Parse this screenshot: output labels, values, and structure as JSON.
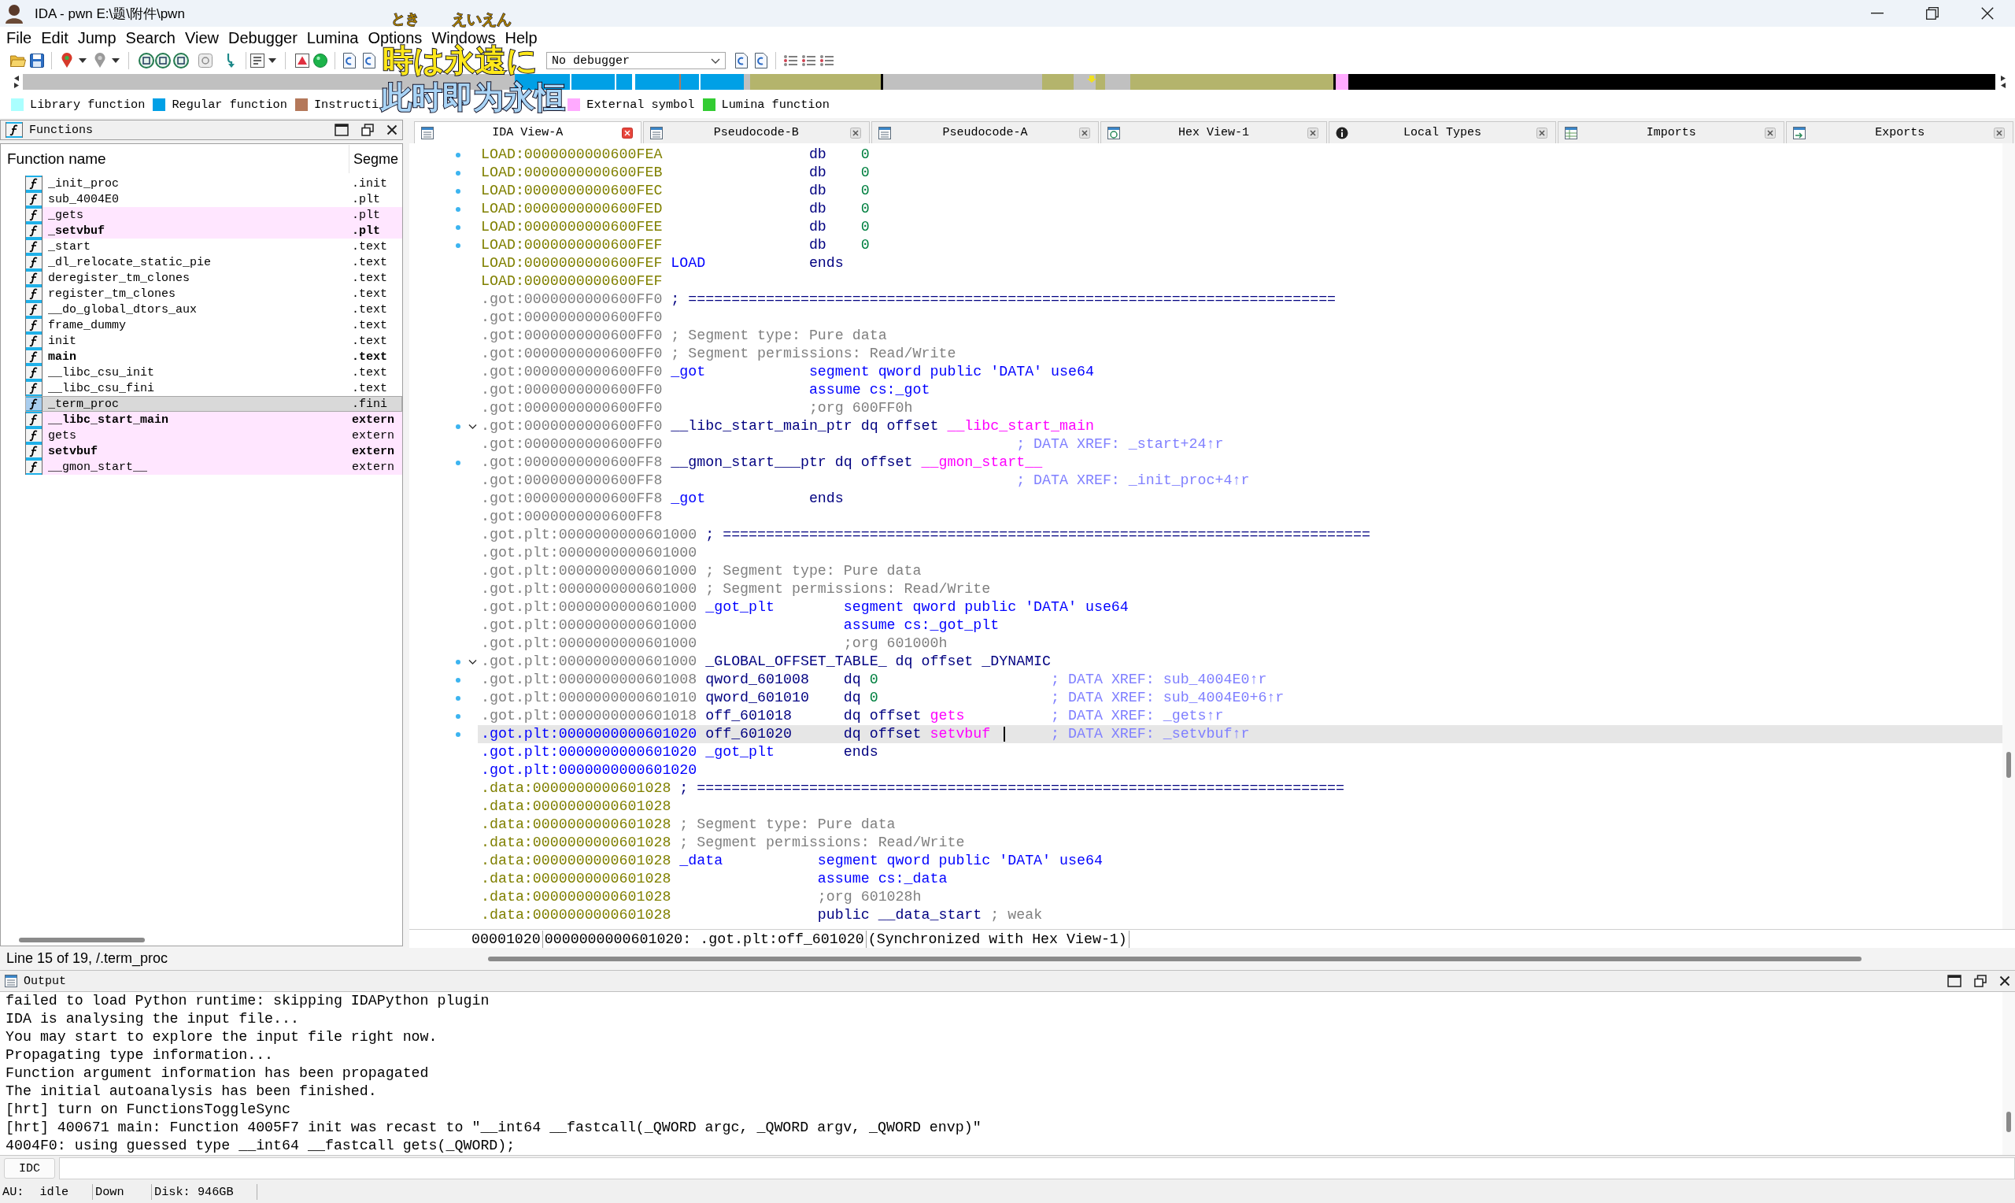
{
  "window": {
    "title": "IDA - pwn E:\\题\\附件\\pwn"
  },
  "menu": [
    "File",
    "Edit",
    "Jump",
    "Search",
    "View",
    "Debugger",
    "Lumina",
    "Options",
    "Windows",
    "Help"
  ],
  "toolbar": {
    "debugger_select": "No debugger"
  },
  "legend": [
    {
      "label": "Library function",
      "color": "#aaffff"
    },
    {
      "label": "Regular function",
      "color": "#00a0e6"
    },
    {
      "label": "Instructi",
      "color": "#b4785a"
    },
    {
      "label": "External symbol",
      "color": "#ffaaff"
    },
    {
      "label": "Lumina function",
      "color": "#33cc33"
    }
  ],
  "lyrics_overlay": {
    "furigana": [
      "とき",
      "えいえん"
    ],
    "lines": [
      "時は永遠に",
      "此时即为永恒"
    ]
  },
  "functions_panel": {
    "title": "Functions",
    "columns": [
      "Function name",
      "Segme"
    ],
    "rows": [
      {
        "name": "_init_proc",
        "segment": ".init",
        "bold": false,
        "color": "#ffffff",
        "selected": false
      },
      {
        "name": "sub_4004E0",
        "segment": ".plt",
        "bold": false,
        "color": "#ffffff",
        "selected": false
      },
      {
        "name": "_gets",
        "segment": ".plt",
        "bold": false,
        "color": "#ffe6ff",
        "selected": false
      },
      {
        "name": "_setvbuf",
        "segment": ".plt",
        "bold": true,
        "color": "#ffe6ff",
        "selected": false
      },
      {
        "name": "_start",
        "segment": ".text",
        "bold": false,
        "color": "#ffffff",
        "selected": false
      },
      {
        "name": "_dl_relocate_static_pie",
        "segment": ".text",
        "bold": false,
        "color": "#ffffff",
        "selected": false
      },
      {
        "name": "deregister_tm_clones",
        "segment": ".text",
        "bold": false,
        "color": "#ffffff",
        "selected": false
      },
      {
        "name": "register_tm_clones",
        "segment": ".text",
        "bold": false,
        "color": "#ffffff",
        "selected": false
      },
      {
        "name": "__do_global_dtors_aux",
        "segment": ".text",
        "bold": false,
        "color": "#ffffff",
        "selected": false
      },
      {
        "name": "frame_dummy",
        "segment": ".text",
        "bold": false,
        "color": "#ffffff",
        "selected": false
      },
      {
        "name": "init",
        "segment": ".text",
        "bold": false,
        "color": "#ffffff",
        "selected": false
      },
      {
        "name": "main",
        "segment": ".text",
        "bold": true,
        "color": "#ffffff",
        "selected": false
      },
      {
        "name": "__libc_csu_init",
        "segment": ".text",
        "bold": false,
        "color": "#ffffff",
        "selected": false
      },
      {
        "name": "__libc_csu_fini",
        "segment": ".text",
        "bold": false,
        "color": "#ffffff",
        "selected": false
      },
      {
        "name": "_term_proc",
        "segment": ".fini",
        "bold": false,
        "selected": true
      },
      {
        "name": "__libc_start_main",
        "segment": "extern",
        "bold": true,
        "color": "#ffe6ff",
        "selected": false
      },
      {
        "name": "gets",
        "segment": "extern",
        "bold": false,
        "color": "#ffe6ff",
        "selected": false
      },
      {
        "name": "setvbuf",
        "segment": "extern",
        "bold": true,
        "color": "#ffe6ff",
        "selected": false
      },
      {
        "name": "__gmon_start__",
        "segment": "extern",
        "bold": false,
        "color": "#ffe6ff",
        "selected": false
      }
    ],
    "status": "Line 15 of 19, /.term_proc"
  },
  "tabs": [
    {
      "label": "IDA View-A",
      "kind": "disassembly",
      "selected": true
    },
    {
      "label": "Pseudocode-B",
      "kind": "pseudocode",
      "selected": false
    },
    {
      "label": "Pseudocode-A",
      "kind": "pseudocode",
      "selected": false
    },
    {
      "label": "Hex View-1",
      "kind": "hex",
      "selected": false
    },
    {
      "label": "Local Types",
      "kind": "types",
      "selected": false
    },
    {
      "label": "Imports",
      "kind": "imports",
      "selected": false
    },
    {
      "label": "Exports",
      "kind": "exports",
      "selected": false
    }
  ],
  "listing": {
    "lines": [
      {
        "address": "LOAD:0000000000600FEA",
        "color": "#808000",
        "marked": true,
        "selected": false,
        "parts": [
          {
            "kind": "code",
            "text": "                 db    "
          },
          {
            "kind": "number",
            "text": "0"
          }
        ]
      },
      {
        "address": "LOAD:0000000000600FEB",
        "color": "#808000",
        "marked": true,
        "selected": false,
        "parts": [
          {
            "kind": "code",
            "text": "                 db    "
          },
          {
            "kind": "number",
            "text": "0"
          }
        ]
      },
      {
        "address": "LOAD:0000000000600FEC",
        "color": "#808000",
        "marked": true,
        "selected": false,
        "parts": [
          {
            "kind": "code",
            "text": "                 db    "
          },
          {
            "kind": "number",
            "text": "0"
          }
        ]
      },
      {
        "address": "LOAD:0000000000600FED",
        "color": "#808000",
        "marked": true,
        "selected": false,
        "parts": [
          {
            "kind": "code",
            "text": "                 db    "
          },
          {
            "kind": "number",
            "text": "0"
          }
        ]
      },
      {
        "address": "LOAD:0000000000600FEE",
        "color": "#808000",
        "marked": true,
        "selected": false,
        "parts": [
          {
            "kind": "code",
            "text": "                 db    "
          },
          {
            "kind": "number",
            "text": "0"
          }
        ]
      },
      {
        "address": "LOAD:0000000000600FEF",
        "color": "#808000",
        "marked": true,
        "selected": false,
        "parts": [
          {
            "kind": "code",
            "text": "                 db    "
          },
          {
            "kind": "number",
            "text": "0"
          }
        ]
      },
      {
        "address": "LOAD:0000000000600FEF",
        "color": "#808000",
        "marked": false,
        "selected": false,
        "parts": [
          {
            "kind": "keyword",
            "text": " LOAD"
          },
          {
            "kind": "code",
            "text": "            ends"
          }
        ]
      },
      {
        "address": "LOAD:0000000000600FEF",
        "color": "#808000",
        "marked": false,
        "selected": false
      },
      {
        "address": ".got:0000000000600FF0",
        "color": "#808080",
        "marked": false,
        "selected": false,
        "parts": [
          {
            "kind": "code",
            "text": " ; ==========================================================================="
          }
        ]
      },
      {
        "address": ".got:0000000000600FF0",
        "color": "#808080",
        "marked": false,
        "selected": false
      },
      {
        "address": ".got:0000000000600FF0",
        "color": "#808080",
        "marked": false,
        "selected": false,
        "parts": [
          {
            "kind": "comment",
            "text": " ; Segment type: Pure data"
          }
        ]
      },
      {
        "address": ".got:0000000000600FF0",
        "color": "#808080",
        "marked": false,
        "selected": false,
        "parts": [
          {
            "kind": "comment",
            "text": " ; Segment permissions: Read/Write"
          }
        ]
      },
      {
        "address": ".got:0000000000600FF0",
        "color": "#808080",
        "marked": false,
        "selected": false,
        "parts": [
          {
            "kind": "keyword",
            "text": " _got            segment qword public 'DATA' use64"
          }
        ]
      },
      {
        "address": ".got:0000000000600FF0",
        "color": "#808080",
        "marked": false,
        "selected": false,
        "parts": [
          {
            "kind": "keyword",
            "text": "                 assume cs:_got"
          }
        ]
      },
      {
        "address": ".got:0000000000600FF0",
        "color": "#808080",
        "marked": false,
        "selected": false,
        "parts": [
          {
            "kind": "comment",
            "text": "                 ;org 600FF0h"
          }
        ]
      },
      {
        "address": ".got:0000000000600FF0",
        "color": "#808080",
        "marked": true,
        "expanded": true,
        "selected": false,
        "parts": [
          {
            "kind": "code",
            "text": " __libc_start_main_ptr dq offset "
          },
          {
            "kind": "import",
            "text": "__libc_start_main"
          }
        ]
      },
      {
        "address": ".got:0000000000600FF0",
        "color": "#808080",
        "marked": false,
        "selected": false,
        "parts": [
          {
            "kind": "xref",
            "text": "                                         ; DATA XREF: _start+24↑r"
          }
        ]
      },
      {
        "address": ".got:0000000000600FF8",
        "color": "#808080",
        "marked": true,
        "selected": false,
        "parts": [
          {
            "kind": "code",
            "text": " __gmon_start___ptr dq offset "
          },
          {
            "kind": "import",
            "text": "__gmon_start__"
          }
        ]
      },
      {
        "address": ".got:0000000000600FF8",
        "color": "#808080",
        "marked": false,
        "selected": false,
        "parts": [
          {
            "kind": "xref",
            "text": "                                         ; DATA XREF: _init_proc+4↑r"
          }
        ]
      },
      {
        "address": ".got:0000000000600FF8",
        "color": "#808080",
        "marked": false,
        "selected": false,
        "parts": [
          {
            "kind": "keyword",
            "text": " _got"
          },
          {
            "kind": "code",
            "text": "            ends"
          }
        ]
      },
      {
        "address": ".got:0000000000600FF8",
        "color": "#808080",
        "marked": false,
        "selected": false
      },
      {
        "address": ".got.plt:0000000000601000",
        "color": "#808080",
        "marked": false,
        "selected": false,
        "parts": [
          {
            "kind": "code",
            "text": " ; ==========================================================================="
          }
        ]
      },
      {
        "address": ".got.plt:0000000000601000",
        "color": "#808080",
        "marked": false,
        "selected": false
      },
      {
        "address": ".got.plt:0000000000601000",
        "color": "#808080",
        "marked": false,
        "selected": false,
        "parts": [
          {
            "kind": "comment",
            "text": " ; Segment type: Pure data"
          }
        ]
      },
      {
        "address": ".got.plt:0000000000601000",
        "color": "#808080",
        "marked": false,
        "selected": false,
        "parts": [
          {
            "kind": "comment",
            "text": " ; Segment permissions: Read/Write"
          }
        ]
      },
      {
        "address": ".got.plt:0000000000601000",
        "color": "#808080",
        "marked": false,
        "selected": false,
        "parts": [
          {
            "kind": "keyword",
            "text": " _got_plt        segment qword public 'DATA' use64"
          }
        ]
      },
      {
        "address": ".got.plt:0000000000601000",
        "color": "#808080",
        "marked": false,
        "selected": false,
        "parts": [
          {
            "kind": "keyword",
            "text": "                 assume cs:_got_plt"
          }
        ]
      },
      {
        "address": ".got.plt:0000000000601000",
        "color": "#808080",
        "marked": false,
        "selected": false,
        "parts": [
          {
            "kind": "comment",
            "text": "                 ;org 601000h"
          }
        ]
      },
      {
        "address": ".got.plt:0000000000601000",
        "color": "#808080",
        "marked": true,
        "expanded": true,
        "selected": false,
        "parts": [
          {
            "kind": "code",
            "text": " _GLOBAL_OFFSET_TABLE_ dq offset _DYNAMIC"
          }
        ]
      },
      {
        "address": ".got.plt:0000000000601008",
        "color": "#808080",
        "marked": true,
        "selected": false,
        "parts": [
          {
            "kind": "code",
            "text": " qword_601008    dq "
          },
          {
            "kind": "number",
            "text": "0"
          },
          {
            "kind": "xref",
            "text": "                    ; DATA XREF: sub_4004E0↑r"
          }
        ]
      },
      {
        "address": ".got.plt:0000000000601010",
        "color": "#808080",
        "marked": true,
        "selected": false,
        "parts": [
          {
            "kind": "code",
            "text": " qword_601010    dq "
          },
          {
            "kind": "number",
            "text": "0"
          },
          {
            "kind": "xref",
            "text": "                    ; DATA XREF: sub_4004E0+6↑r"
          }
        ]
      },
      {
        "address": ".got.plt:0000000000601018",
        "color": "#808080",
        "marked": true,
        "selected": false,
        "parts": [
          {
            "kind": "code",
            "text": " off_601018      dq offset "
          },
          {
            "kind": "import",
            "text": "gets"
          },
          {
            "kind": "xref",
            "text": "          ; DATA XREF: _gets↑r"
          }
        ]
      },
      {
        "address": ".got.plt:0000000000601020",
        "color": "#0000ff",
        "marked": true,
        "selected": true,
        "parts": [
          {
            "kind": "code",
            "text": " off_601020      dq offset "
          },
          {
            "kind": "import",
            "text": "setvbuf"
          },
          {
            "kind": "caret"
          },
          {
            "kind": "xref",
            "text": "       ; DATA XREF: _setvbuf↑r"
          }
        ]
      },
      {
        "address": ".got.plt:0000000000601020",
        "color": "#0000ff",
        "marked": false,
        "selected": false,
        "parts": [
          {
            "kind": "keyword",
            "text": " _got_plt"
          },
          {
            "kind": "code",
            "text": "        ends"
          }
        ]
      },
      {
        "address": ".got.plt:0000000000601020",
        "color": "#0000ff",
        "marked": false,
        "selected": false
      },
      {
        "address": ".data:0000000000601028",
        "color": "#808000",
        "marked": false,
        "selected": false,
        "parts": [
          {
            "kind": "code",
            "text": " ; ==========================================================================="
          }
        ]
      },
      {
        "address": ".data:0000000000601028",
        "color": "#808000",
        "marked": false,
        "selected": false
      },
      {
        "address": ".data:0000000000601028",
        "color": "#808000",
        "marked": false,
        "selected": false,
        "parts": [
          {
            "kind": "comment",
            "text": " ; Segment type: Pure data"
          }
        ]
      },
      {
        "address": ".data:0000000000601028",
        "color": "#808000",
        "marked": false,
        "selected": false,
        "parts": [
          {
            "kind": "comment",
            "text": " ; Segment permissions: Read/Write"
          }
        ]
      },
      {
        "address": ".data:0000000000601028",
        "color": "#808000",
        "marked": false,
        "selected": false,
        "parts": [
          {
            "kind": "keyword",
            "text": " _data           segment qword public 'DATA' use64"
          }
        ]
      },
      {
        "address": ".data:0000000000601028",
        "color": "#808000",
        "marked": false,
        "selected": false,
        "parts": [
          {
            "kind": "keyword",
            "text": "                 assume cs:_data"
          }
        ]
      },
      {
        "address": ".data:0000000000601028",
        "color": "#808000",
        "marked": false,
        "selected": false,
        "parts": [
          {
            "kind": "comment",
            "text": "                 ;org 601028h"
          }
        ]
      },
      {
        "address": ".data:0000000000601028",
        "color": "#808000",
        "marked": false,
        "selected": false,
        "parts": [
          {
            "kind": "code",
            "text": "                 public __data_start "
          },
          {
            "kind": "comment",
            "text": "; weak"
          }
        ]
      }
    ],
    "status": [
      "00001020",
      "0000000000601020: .got.plt:off_601020",
      "(Synchronized with Hex View-1)"
    ]
  },
  "output": {
    "title": "Output",
    "lines": [
      "failed to load Python runtime: skipping IDAPython plugin",
      "IDA is analysing the input file...",
      "You may start to explore the input file right now.",
      "Propagating type information...",
      "Function argument information has been propagated",
      "The initial autoanalysis has been finished.",
      "[hrt] turn on FunctionsToggleSync",
      "[hrt] 400671 main: Function 4005F7 init was recast to \"__int64 __fastcall(_QWORD argc, _QWORD argv, _QWORD envp)\"",
      "4004F0: using guessed type __int64 __fastcall gets(_QWORD);"
    ]
  },
  "idc": {
    "label": "IDC"
  },
  "status_bar": [
    "AU:",
    "idle",
    "Down",
    "Disk: 946GB"
  ]
}
